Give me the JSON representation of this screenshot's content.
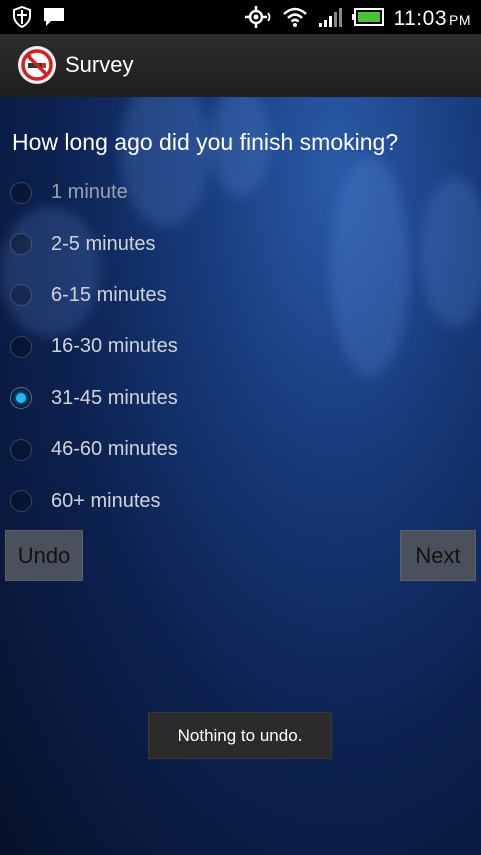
{
  "status_bar": {
    "time": "11:03",
    "ampm": "PM",
    "icons": [
      "shield-icon",
      "message-icon",
      "gps-icon",
      "wifi-icon",
      "signal-icon",
      "battery-icon"
    ]
  },
  "action_bar": {
    "title": "Survey",
    "app_icon": "no-smoking-icon"
  },
  "survey": {
    "question": "How long ago did you finish smoking?",
    "options": [
      {
        "label": "1 minute",
        "checked": false
      },
      {
        "label": "2-5 minutes",
        "checked": false
      },
      {
        "label": "6-15 minutes",
        "checked": false
      },
      {
        "label": "16-30 minutes",
        "checked": false
      },
      {
        "label": "31-45 minutes",
        "checked": true
      },
      {
        "label": "46-60 minutes",
        "checked": false
      },
      {
        "label": "60+ minutes",
        "checked": false
      }
    ],
    "undo_label": "Undo",
    "next_label": "Next"
  },
  "toast": {
    "message": "Nothing to undo."
  },
  "colors": {
    "accent": "#24b7f2",
    "background": "#0d2150"
  }
}
